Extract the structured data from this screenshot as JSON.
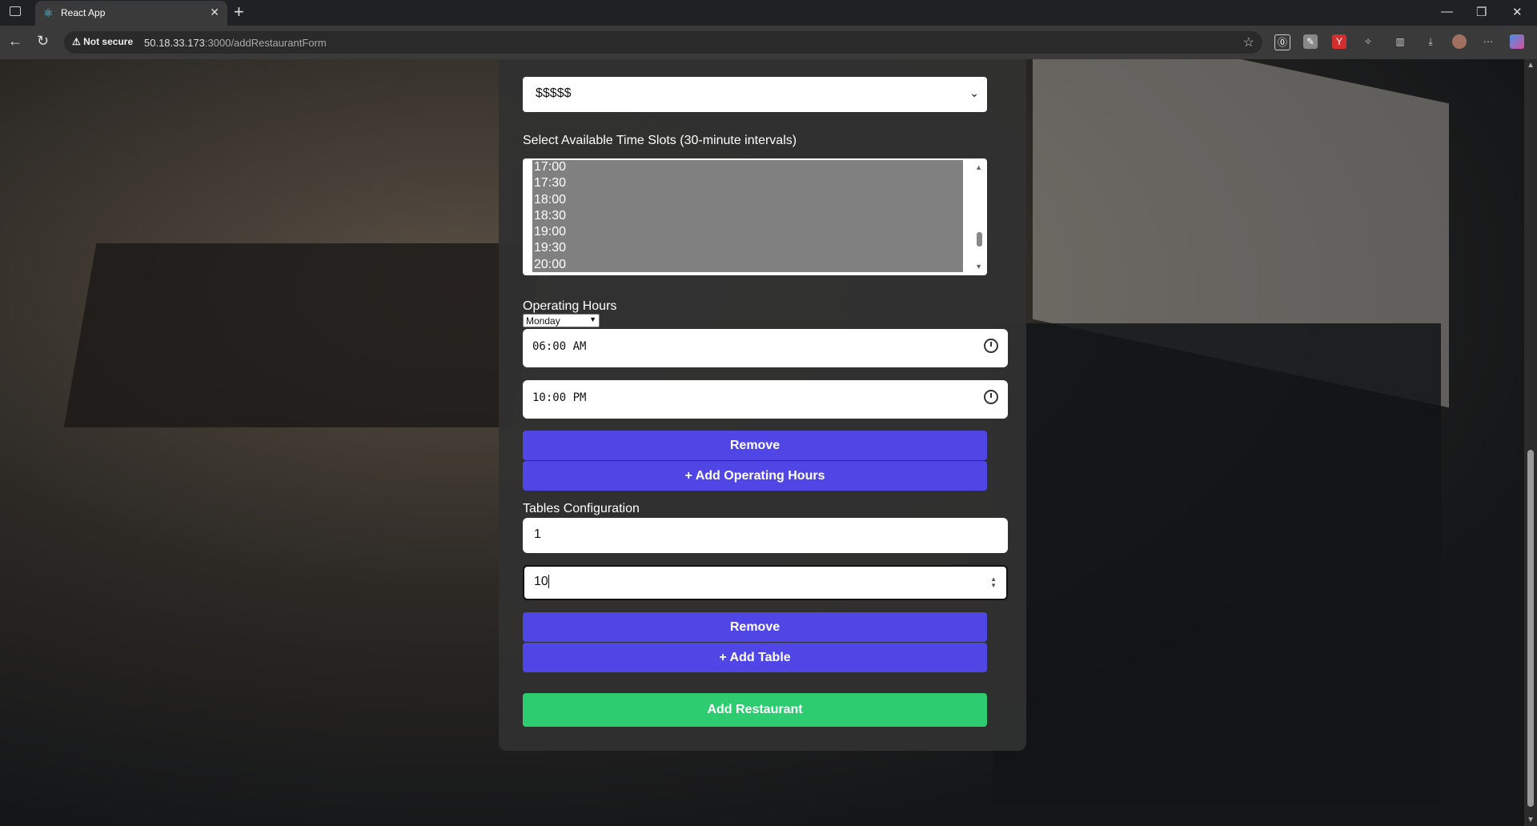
{
  "browser": {
    "tab_title": "React App",
    "security_label": "Not secure",
    "url_host": "50.18.33.173",
    "url_path": ":3000/addRestaurantForm"
  },
  "form": {
    "price_value": "$$$$$",
    "time_slots_label": "Select Available Time Slots (30-minute intervals)",
    "time_slots": [
      "17:00",
      "17:30",
      "18:00",
      "18:30",
      "19:00",
      "19:30",
      "20:00"
    ],
    "operating_hours_label": "Operating Hours",
    "day_value": "Monday",
    "open_time": "06:00 AM",
    "close_time": "10:00 PM",
    "remove_hours_label": "Remove",
    "add_hours_label": "+ Add Operating Hours",
    "tables_label": "Tables Configuration",
    "table_number": "1",
    "table_capacity": "10",
    "remove_table_label": "Remove",
    "add_table_label": "+ Add Table",
    "submit_label": "Add Restaurant"
  }
}
